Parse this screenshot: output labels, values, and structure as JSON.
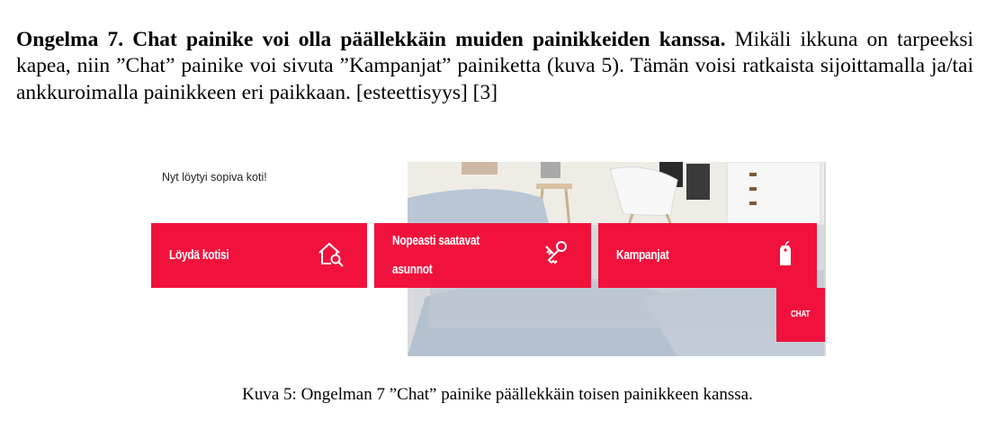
{
  "paragraph": {
    "bold_lead": "Ongelma 7. Chat painike voi olla päällekkäin muiden painikkeiden kanssa.",
    "body": "Mikäli ikkuna on tarpeeksi kapea, niin ”Chat” painike voi sivuta ”Kampanjat” painiketta (kuva 5). Tämän voisi ratkaista sijoittamalla ja/tai ankkuroimalla painikkeen eri paikkaan. [esteettisyys] [3]"
  },
  "figure": {
    "heading": "Nyt löytyi sopiva koti!",
    "buttons": {
      "find_home": {
        "label": "Löydä kotisi",
        "icon": "house-search-icon"
      },
      "quick_available": {
        "label": "Nopeasti saatavat asunnot",
        "icon": "keys-icon"
      },
      "campaigns": {
        "label": "Kampanjat",
        "icon": "tag-icon"
      },
      "chat": {
        "label": "CHAT"
      }
    },
    "accent_color": "#f0123c"
  },
  "caption": "Kuva 5: Ongelman 7 ”Chat” painike päällekkäin toisen painikkeen kanssa."
}
